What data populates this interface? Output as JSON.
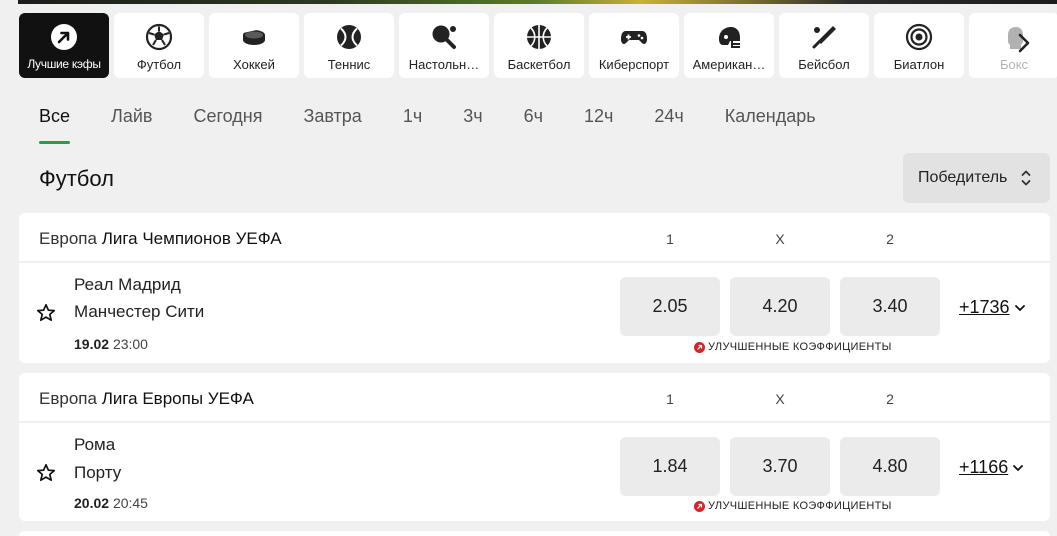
{
  "sports": [
    {
      "label": "Лучшие кэфы",
      "icon": "arrow-up-right-icon",
      "active": true
    },
    {
      "label": "Футбол",
      "icon": "soccer-ball-icon"
    },
    {
      "label": "Хоккей",
      "icon": "hockey-puck-icon"
    },
    {
      "label": "Теннис",
      "icon": "tennis-ball-icon"
    },
    {
      "label": "Настольн…",
      "icon": "table-tennis-icon"
    },
    {
      "label": "Баскетбол",
      "icon": "basketball-icon"
    },
    {
      "label": "Киберспорт",
      "icon": "gamepad-icon"
    },
    {
      "label": "Американ…",
      "icon": "football-helmet-icon"
    },
    {
      "label": "Бейсбол",
      "icon": "baseball-bat-icon"
    },
    {
      "label": "Биатлон",
      "icon": "target-icon"
    },
    {
      "label": "Бокс",
      "icon": "boxing-glove-icon",
      "faded": true
    }
  ],
  "time_tabs": [
    "Все",
    "Лайв",
    "Сегодня",
    "Завтра",
    "1ч",
    "3ч",
    "6ч",
    "12ч",
    "24ч",
    "Календарь"
  ],
  "section_title": "Футбол",
  "market_select": "Победитель",
  "columns": [
    "1",
    "X",
    "2"
  ],
  "boost_label": "УЛУЧШЕННЫЕ КОЭФФИЦИЕНТЫ",
  "leagues": [
    {
      "region": "Европа",
      "name": "Лига Чемпионов УЕФА",
      "event": {
        "home": "Реал Мадрид",
        "away": "Манчестер Сити",
        "date": "19.02",
        "time": "23:00",
        "odds": [
          "2.05",
          "4.20",
          "3.40"
        ],
        "more": "+1736"
      }
    },
    {
      "region": "Европа",
      "name": "Лига Европы УЕФА",
      "event": {
        "home": "Рома",
        "away": "Порту",
        "date": "20.02",
        "time": "20:45",
        "odds": [
          "1.84",
          "3.70",
          "4.80"
        ],
        "more": "+1166"
      }
    }
  ],
  "colors": {
    "accent": "#2c9b4a",
    "boost": "#d8232a",
    "active_tile": "#111111"
  }
}
